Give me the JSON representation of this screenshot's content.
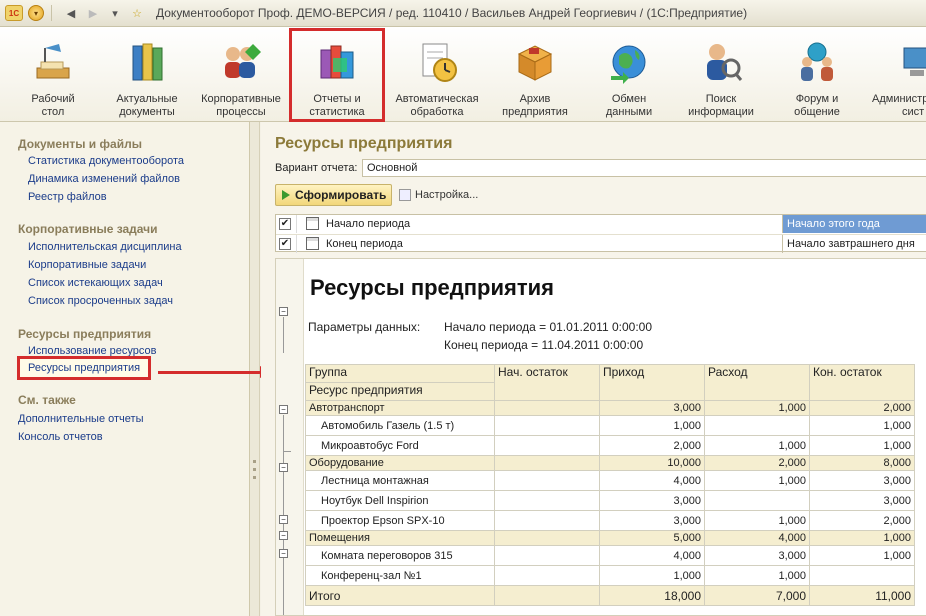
{
  "window": {
    "title": "Документооборот Проф. ДЕМО-ВЕРСИЯ / ред. 110410 / Васильев Андрей Георгиевич /  (1С:Предприятие)",
    "logo": "1С"
  },
  "toolbar": [
    {
      "label1": "Рабочий",
      "label2": "стол",
      "icon": "desk-lamp-icon"
    },
    {
      "label1": "Актуальные",
      "label2": "документы",
      "icon": "binders-icon"
    },
    {
      "label1": "Корпоративные",
      "label2": "процессы",
      "icon": "people-process-icon"
    },
    {
      "label1": "Отчеты и",
      "label2": "статистика",
      "icon": "reports-books-icon"
    },
    {
      "label1": "Автоматическая",
      "label2": "обработка",
      "icon": "clock-document-icon"
    },
    {
      "label1": "Архив",
      "label2": "предприятия",
      "icon": "archive-box-icon"
    },
    {
      "label1": "Обмен",
      "label2": "данными",
      "icon": "globe-exchange-icon"
    },
    {
      "label1": "Поиск",
      "label2": "информации",
      "icon": "person-search-icon"
    },
    {
      "label1": "Форум и",
      "label2": "общение",
      "icon": "forum-people-icon"
    },
    {
      "label1": "Администр",
      "label2": "сист",
      "icon": "admin-computer-icon"
    }
  ],
  "sidebar": {
    "sections": [
      {
        "title": "Документы и файлы",
        "items": [
          "Статистика документооборота",
          "Динамика изменений файлов",
          "Реестр файлов"
        ]
      },
      {
        "title": "Корпоративные задачи",
        "items": [
          "Исполнительская дисциплина",
          "Корпоративные задачи",
          "Список истекающих задач",
          "Список просроченных задач"
        ]
      },
      {
        "title": "Ресурсы предприятия",
        "items": [
          "Использование ресурсов",
          "Ресурсы предприятия"
        ]
      },
      {
        "title": "См. также",
        "items": [
          "Дополнительные отчеты",
          "Консоль отчетов"
        ]
      }
    ]
  },
  "main": {
    "title": "Ресурсы предприятия",
    "variant_label": "Вариант отчета:",
    "variant_value": "Основной",
    "generate_label": "Сформировать",
    "settings_label": "Настройка...",
    "params": [
      {
        "name": "Начало периода",
        "value": "Начало этого года",
        "checked": true
      },
      {
        "name": "Конец периода",
        "value": "Начало завтрашнего дня",
        "checked": true
      }
    ]
  },
  "report": {
    "title": "Ресурсы предприятия",
    "params_label": "Параметры данных:",
    "param_lines": [
      "Начало периода = 01.01.2011 0:00:00",
      "Конец периода = 11.04.2011 0:00:00"
    ],
    "columns": [
      "Группа",
      "Нач. остаток",
      "Приход",
      "Расход",
      "Кон. остаток"
    ],
    "subcolumn": "Ресурс предприятия",
    "rows": [
      {
        "type": "group",
        "name": "Автотранспорт",
        "start": "",
        "in": "3,000",
        "out": "1,000",
        "end": "2,000"
      },
      {
        "type": "item",
        "name": "Автомобиль Газель (1.5 т)",
        "start": "",
        "in": "1,000",
        "out": "",
        "end": "1,000"
      },
      {
        "type": "item",
        "name": "Микроавтобус Ford",
        "start": "",
        "in": "2,000",
        "out": "1,000",
        "end": "1,000"
      },
      {
        "type": "group",
        "name": "Оборудование",
        "start": "",
        "in": "10,000",
        "out": "2,000",
        "end": "8,000"
      },
      {
        "type": "item",
        "name": "Лестница монтажная",
        "start": "",
        "in": "4,000",
        "out": "1,000",
        "end": "3,000"
      },
      {
        "type": "item",
        "name": "Ноутбук Dell Inspirion",
        "start": "",
        "in": "3,000",
        "out": "",
        "end": "3,000"
      },
      {
        "type": "item",
        "name": "Проектор Epson SPX-10",
        "start": "",
        "in": "3,000",
        "out": "1,000",
        "end": "2,000"
      },
      {
        "type": "group",
        "name": "Помещения",
        "start": "",
        "in": "5,000",
        "out": "4,000",
        "end": "1,000"
      },
      {
        "type": "item",
        "name": "Комната переговоров 315",
        "start": "",
        "in": "4,000",
        "out": "3,000",
        "end": "1,000"
      },
      {
        "type": "item",
        "name": "Конференц-зал №1",
        "start": "",
        "in": "1,000",
        "out": "1,000",
        "end": ""
      }
    ],
    "total": {
      "name": "Итого",
      "start": "",
      "in": "18,000",
      "out": "7,000",
      "end": "11,000"
    }
  },
  "colors": {
    "accent_red": "#d42c2c",
    "title_gold": "#8c7a3a",
    "link_blue": "#1b3c8a",
    "selection_blue": "#6f9bd3"
  }
}
